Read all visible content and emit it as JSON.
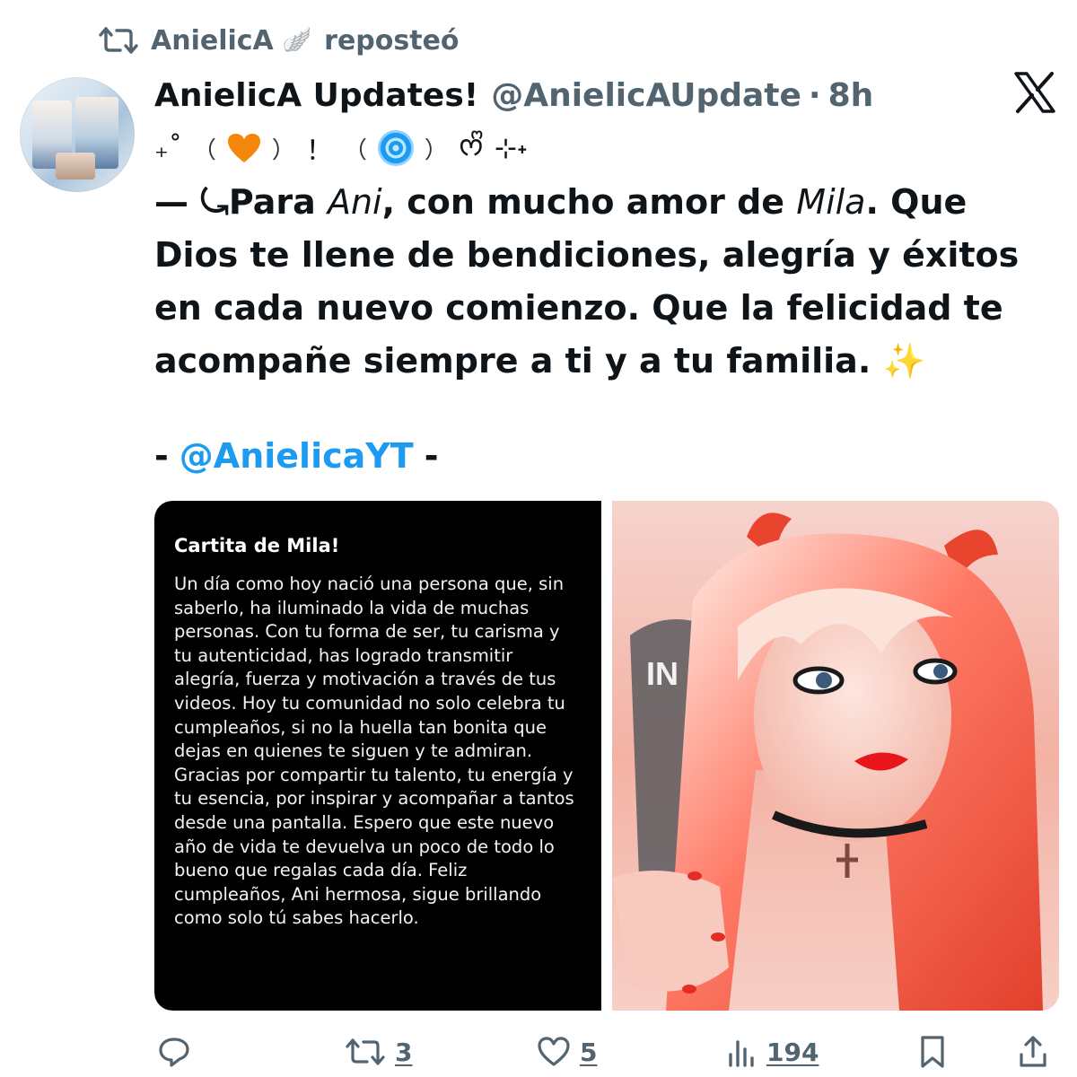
{
  "repost": {
    "account": "AnielicA",
    "badge": "🪽",
    "label": "reposteó"
  },
  "tweet": {
    "display_name": "AnielicA Updates!",
    "handle": "@AnielicAUpdate",
    "separator": "·",
    "time": "8h",
    "deco": {
      "sparkle_left": "₊˚",
      "paren_open_1": "（",
      "paren_close_1": "）",
      "exclamation": "！",
      "paren_open_2": "（",
      "paren_close_2": "）",
      "ribbon": "ᰔᩚ",
      "tail": "⊹˖"
    },
    "text": {
      "lead": "— ⤿Para ",
      "name1": "Ani",
      "mid1": ", con mucho amor de ",
      "name2": "Mila",
      "rest": ". Que Dios te llene de bendiciones, alegría y éxitos en cada nuevo comienzo. Que la felicidad te acompañe siempre a ti y a tu familia. ",
      "sparkles": "✨"
    },
    "mention_prefix": "-",
    "mention": "@AnielicaYT",
    "mention_suffix": "-",
    "letter": {
      "title": "Cartita de Mila!",
      "body": "Un día como hoy nació una persona que, sin saberlo, ha iluminado la vida de muchas personas. Con tu forma de ser, tu carisma y tu autenticidad, has logrado transmitir alegría, fuerza y motivación a través de tus videos. Hoy tu comunidad no solo celebra tu cumpleaños, si no la huella tan bonita que dejas en quienes te siguen y te admiran. Gracias por compartir tu talento, tu energía y tu esencia, por inspirar y acompañar a tantos desde una pantalla. Espero que este nuevo año de vida te devuelva un poco de todo lo bueno que regalas cada día. Feliz cumpleaños, Ani hermosa, sigue brillando como solo tú sabes hacerlo."
    },
    "photo_chair_text": "IN"
  },
  "actions": {
    "reply_count": "",
    "repost_count": "3",
    "like_count": "5",
    "views_count": "194"
  },
  "colors": {
    "accent": "#1d9bf0",
    "secondary_text": "#536471",
    "primary_text": "#0f1419"
  }
}
